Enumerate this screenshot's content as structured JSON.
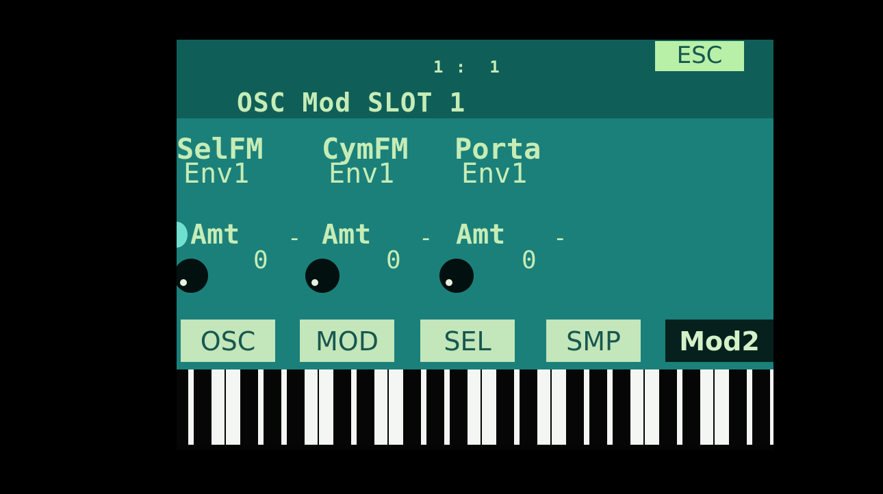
{
  "header": {
    "position": "1 :  1",
    "title": "OSC Mod SLOT 1",
    "esc_label": "ESC"
  },
  "slots": [
    {
      "destination": "SelFM",
      "source": "Env1",
      "amount_label": "Amt",
      "dash": "-",
      "value": "0"
    },
    {
      "destination": "CymFM",
      "source": "Env1",
      "amount_label": "Amt",
      "dash": "-",
      "value": "0"
    },
    {
      "destination": "Porta",
      "source": "Env1",
      "amount_label": "Amt",
      "dash": "-",
      "value": "0"
    }
  ],
  "tabs": [
    {
      "label": "OSC",
      "active": false
    },
    {
      "label": "MOD",
      "active": false
    },
    {
      "label": "SEL",
      "active": false
    },
    {
      "label": "SMP",
      "active": false
    },
    {
      "label": "Mod2",
      "active": true
    }
  ],
  "colors": {
    "screen_bg": "#1b807a",
    "header_bg": "#0f5f58",
    "text": "#c6ecb6",
    "esc_bg": "#b8f0a8",
    "tab_bg": "#c3e6ba",
    "tab_active_bg": "#06201d"
  }
}
